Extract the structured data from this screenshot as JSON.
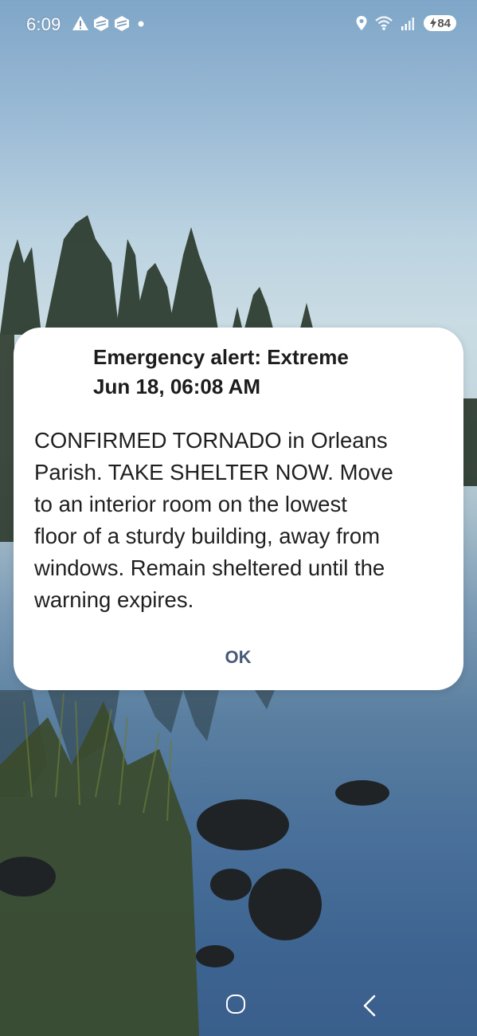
{
  "status_bar": {
    "time": "6:09",
    "left_icons": [
      "warning-icon",
      "notification-box-icon",
      "notification-box-icon",
      "dot-icon"
    ],
    "right_icons": [
      "location-icon",
      "wifi-icon",
      "signal-icon"
    ],
    "battery_level": "84",
    "charging": true
  },
  "alert": {
    "title_line1": "Emergency alert: Extreme",
    "title_line2": "Jun 18, 06:08 AM",
    "body_line1": "CONFIRMED TORNADO in Orleans",
    "body_line2": "Parish. TAKE SHELTER NOW. Move",
    "body_line3": "to an interior room on the lowest",
    "body_line4": "floor of a sturdy building, away from",
    "body_line5": "windows. Remain sheltered until the",
    "body_line6": "warning expires.",
    "ok_label": "OK"
  },
  "nav_bar": {
    "icons": [
      "home-icon",
      "back-icon"
    ]
  },
  "colors": {
    "dialog_bg": "#ffffff",
    "ok_text": "#475a78",
    "sky_top": "#7fa6c8",
    "water": "#3d6390"
  }
}
